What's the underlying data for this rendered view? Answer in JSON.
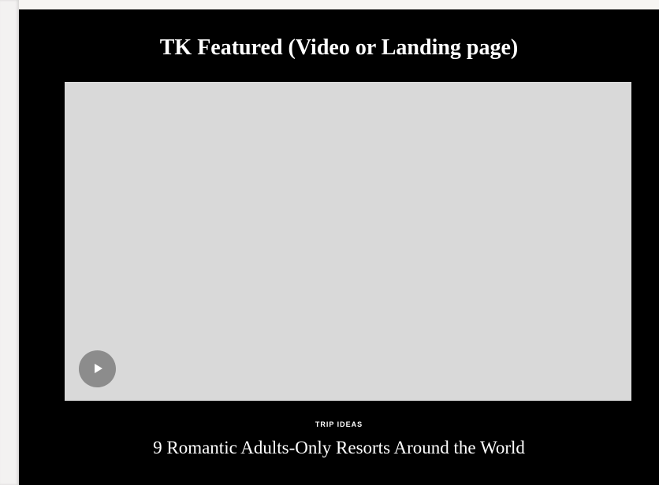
{
  "featured": {
    "title": "TK Featured (Video or Landing page)",
    "video": {
      "play_icon": "play-icon",
      "placeholder_color": "#d9d9d9"
    },
    "category": "TRIP IDEAS",
    "headline": "9 Romantic Adults-Only Resorts Around the World"
  },
  "colors": {
    "section_background": "#000000",
    "text": "#ffffff",
    "play_button": "#8c8c8c"
  }
}
